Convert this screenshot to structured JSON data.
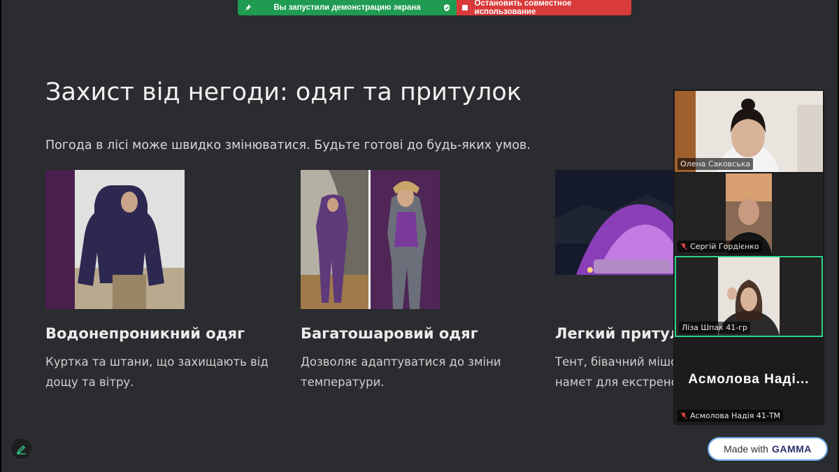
{
  "share_bar": {
    "status": "Вы запустили демонстрацию экрана",
    "stop": "Остановить совместное использование",
    "status_color": "#1f9b52",
    "stop_color": "#d93a3a"
  },
  "slide": {
    "title": "Захист від негоди: одяг та притулок",
    "subtitle": "Погода в лісі може швидко змінюватися. Будьте готові до будь-яких умов.",
    "cards": [
      {
        "title": "Водонепроникний одяг",
        "desc1": "Куртка та штани, що захищають від",
        "desc2": "дощу та вітру."
      },
      {
        "title": "Багатошаровий одяг",
        "desc1": "Дозволяє адаптуватися до зміни",
        "desc2": "температури."
      },
      {
        "title": "Легкий притулок",
        "desc1": "Тент, бівачний мішок або",
        "desc2": "намет для екстреної ситуації."
      }
    ]
  },
  "badge": {
    "prefix": "Made with",
    "brand": "GAMMA"
  },
  "participants": [
    {
      "name": "Олена Саковська",
      "muted": false
    },
    {
      "name": "Сергій Гордієнко",
      "muted": true
    },
    {
      "name": "Ліза Шпак 41-гр",
      "muted": false,
      "active": true
    },
    {
      "name": "Асмолова Надія 41-ТМ",
      "display": "Асмолова Наді...",
      "muted": true
    }
  ],
  "accent_color": "#2fd38c"
}
